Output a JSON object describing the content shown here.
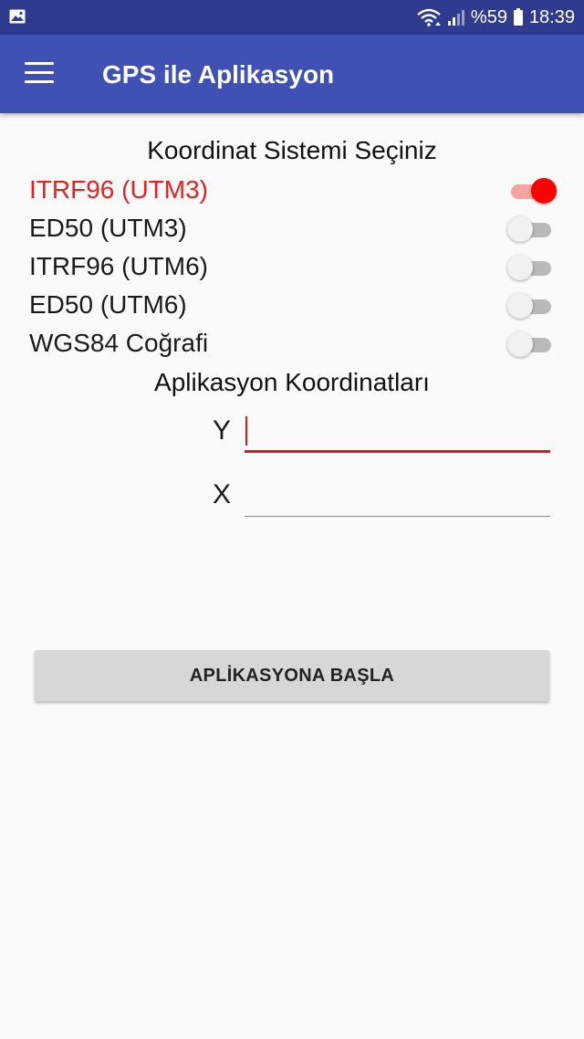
{
  "status_bar": {
    "battery_text": "%59",
    "time": "18:39",
    "icons": [
      "gallery-icon",
      "wifi-icon",
      "signal-icon",
      "battery-icon"
    ]
  },
  "app_bar": {
    "title": "GPS ile Aplikasyon",
    "menu_icon": "hamburger-menu-icon"
  },
  "coordinate_system": {
    "heading": "Koordinat Sistemi Seçiniz",
    "options": [
      {
        "label": "ITRF96 (UTM3)",
        "checked": true
      },
      {
        "label": "ED50 (UTM3)",
        "checked": false
      },
      {
        "label": "ITRF96 (UTM6)",
        "checked": false
      },
      {
        "label": "ED50 (UTM6)",
        "checked": false
      },
      {
        "label": "WGS84 Coğrafi",
        "checked": false
      }
    ]
  },
  "coordinates": {
    "heading": "Aplikasyon Koordinatları",
    "y_label": "Y",
    "y_value": "",
    "x_label": "X",
    "x_value": ""
  },
  "actions": {
    "start_label": "APLİKASYONA BAŞLA"
  },
  "colors": {
    "status_bar": "#2f3b8f",
    "app_bar": "#3f51b5",
    "accent": "#ff0000",
    "selected_text": "#e52222"
  }
}
